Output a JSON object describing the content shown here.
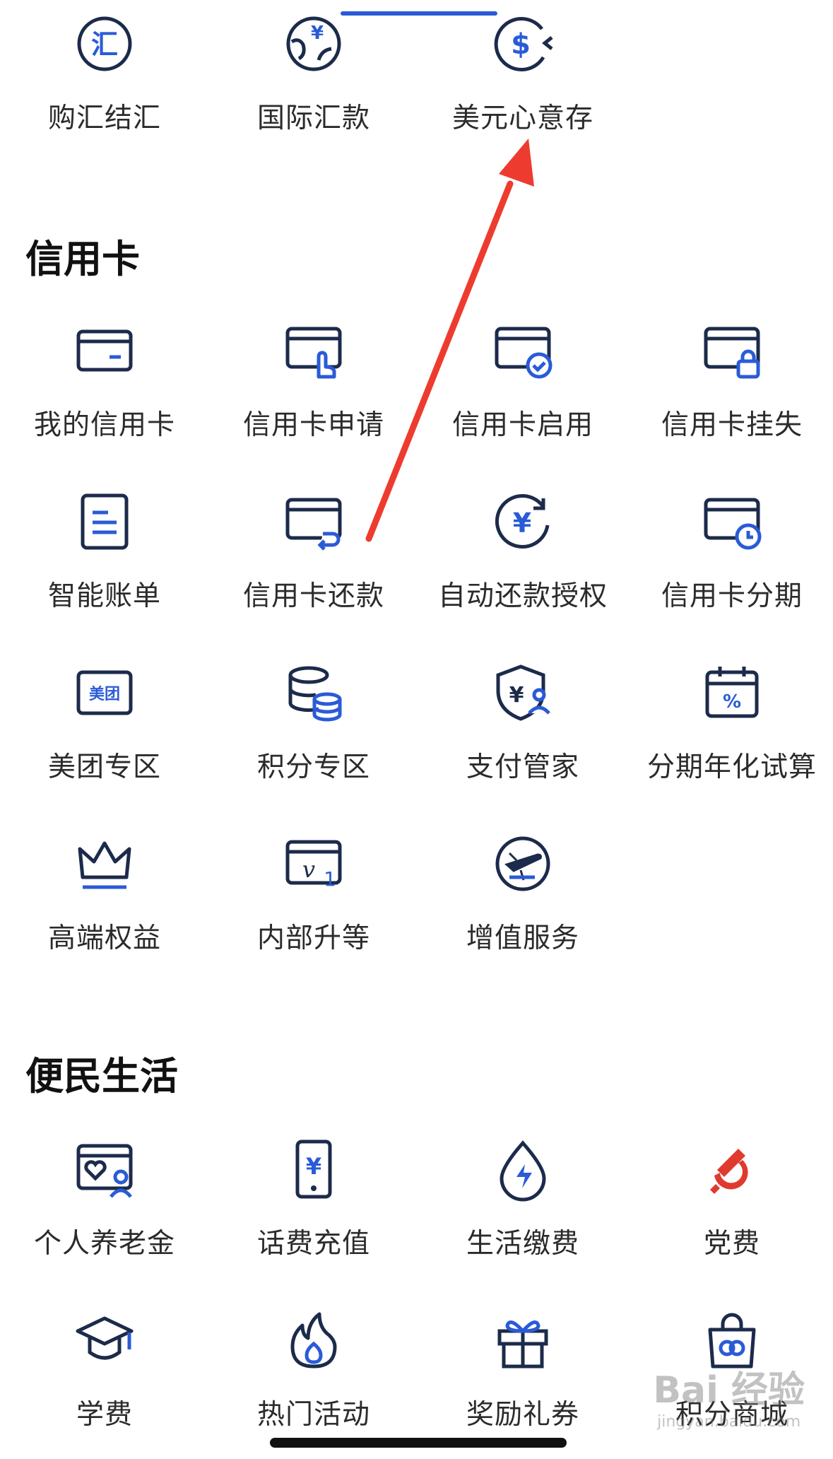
{
  "colors": {
    "icon_dark": "#1c2b4b",
    "icon_accent": "#2a5bd7",
    "party_red": "#e03a2f",
    "annotation_red": "#ee3b2f"
  },
  "top_items": [
    {
      "label": "购汇结汇",
      "icon": "exchange-icon"
    },
    {
      "label": "国际汇款",
      "icon": "globe-yuan-icon"
    },
    {
      "label": "美元心意存",
      "icon": "dollar-deposit-icon"
    }
  ],
  "credit_section": {
    "title": "信用卡",
    "items": [
      {
        "label": "我的信用卡",
        "icon": "credit-card-icon"
      },
      {
        "label": "信用卡申请",
        "icon": "card-apply-icon"
      },
      {
        "label": "信用卡启用",
        "icon": "card-activate-icon"
      },
      {
        "label": "信用卡挂失",
        "icon": "card-lock-icon"
      },
      {
        "label": "智能账单",
        "icon": "bill-icon"
      },
      {
        "label": "信用卡还款",
        "icon": "card-repay-icon"
      },
      {
        "label": "自动还款授权",
        "icon": "auto-repay-icon"
      },
      {
        "label": "信用卡分期",
        "icon": "card-installment-icon"
      },
      {
        "label": "美团专区",
        "icon": "meituan-icon",
        "icon_text": "美团"
      },
      {
        "label": "积分专区",
        "icon": "points-coins-icon"
      },
      {
        "label": "支付管家",
        "icon": "payment-shield-icon"
      },
      {
        "label": "分期年化试算",
        "icon": "calendar-percent-icon"
      },
      {
        "label": "高端权益",
        "icon": "crown-icon"
      },
      {
        "label": "内部升等",
        "icon": "upgrade-card-icon"
      },
      {
        "label": "增值服务",
        "icon": "plane-service-icon"
      }
    ]
  },
  "life_section": {
    "title": "便民生活",
    "items": [
      {
        "label": "个人养老金",
        "icon": "pension-card-icon"
      },
      {
        "label": "话费充值",
        "icon": "phone-topup-icon"
      },
      {
        "label": "生活缴费",
        "icon": "utility-drop-icon"
      },
      {
        "label": "党费",
        "icon": "party-emblem-icon"
      },
      {
        "label": "学费",
        "icon": "graduation-cap-icon"
      },
      {
        "label": "热门活动",
        "icon": "flame-icon"
      },
      {
        "label": "奖励礼券",
        "icon": "gift-icon"
      },
      {
        "label": "积分商城",
        "icon": "shopping-bag-icon"
      }
    ]
  },
  "watermark": {
    "main": "Bai 经验",
    "sub": "jingyan.baidu.com"
  }
}
